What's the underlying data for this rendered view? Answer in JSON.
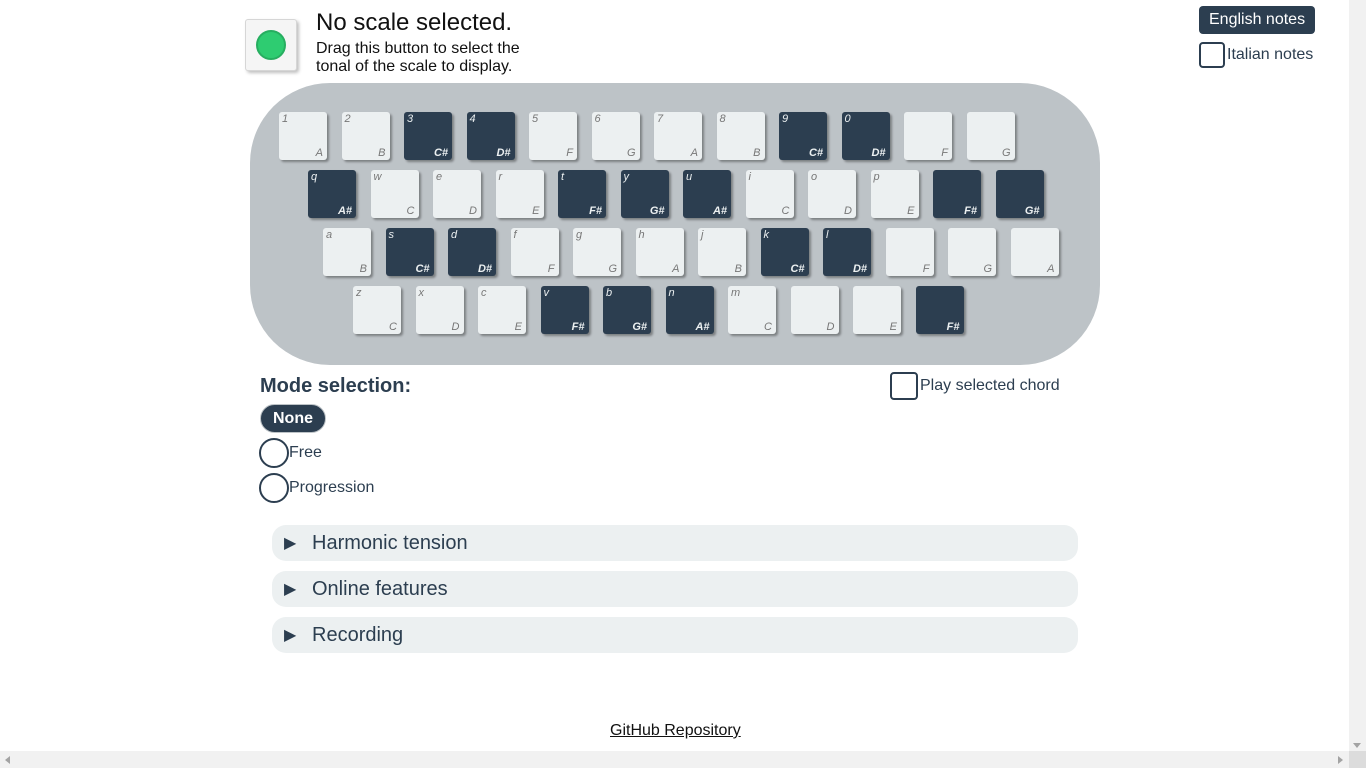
{
  "scale": {
    "title": "No scale selected.",
    "hint": "Drag this button to select the tonal of the scale to display."
  },
  "notes": {
    "english_label": "English notes",
    "italian_label": "Italian notes"
  },
  "keyboard": {
    "rows": [
      [
        {
          "key": "1",
          "note": "A",
          "color": "white"
        },
        {
          "key": "2",
          "note": "B",
          "color": "white"
        },
        {
          "key": "3",
          "note": "C#",
          "color": "black"
        },
        {
          "key": "4",
          "note": "D#",
          "color": "black"
        },
        {
          "key": "5",
          "note": "F",
          "color": "white"
        },
        {
          "key": "6",
          "note": "G",
          "color": "white"
        },
        {
          "key": "7",
          "note": "A",
          "color": "white"
        },
        {
          "key": "8",
          "note": "B",
          "color": "white"
        },
        {
          "key": "9",
          "note": "C#",
          "color": "black"
        },
        {
          "key": "0",
          "note": "D#",
          "color": "black"
        },
        {
          "key": "",
          "note": "F",
          "color": "white"
        },
        {
          "key": "",
          "note": "G",
          "color": "white"
        }
      ],
      [
        {
          "key": "q",
          "note": "A#",
          "color": "black"
        },
        {
          "key": "w",
          "note": "C",
          "color": "white"
        },
        {
          "key": "e",
          "note": "D",
          "color": "white"
        },
        {
          "key": "r",
          "note": "E",
          "color": "white"
        },
        {
          "key": "t",
          "note": "F#",
          "color": "black"
        },
        {
          "key": "y",
          "note": "G#",
          "color": "black"
        },
        {
          "key": "u",
          "note": "A#",
          "color": "black"
        },
        {
          "key": "i",
          "note": "C",
          "color": "white"
        },
        {
          "key": "o",
          "note": "D",
          "color": "white"
        },
        {
          "key": "p",
          "note": "E",
          "color": "white"
        },
        {
          "key": "",
          "note": "F#",
          "color": "black"
        },
        {
          "key": "",
          "note": "G#",
          "color": "black"
        }
      ],
      [
        {
          "key": "a",
          "note": "B",
          "color": "white"
        },
        {
          "key": "s",
          "note": "C#",
          "color": "black"
        },
        {
          "key": "d",
          "note": "D#",
          "color": "black"
        },
        {
          "key": "f",
          "note": "F",
          "color": "white"
        },
        {
          "key": "g",
          "note": "G",
          "color": "white"
        },
        {
          "key": "h",
          "note": "A",
          "color": "white"
        },
        {
          "key": "j",
          "note": "B",
          "color": "white"
        },
        {
          "key": "k",
          "note": "C#",
          "color": "black"
        },
        {
          "key": "l",
          "note": "D#",
          "color": "black"
        },
        {
          "key": "",
          "note": "F",
          "color": "white"
        },
        {
          "key": "",
          "note": "G",
          "color": "white"
        },
        {
          "key": "",
          "note": "A",
          "color": "white"
        }
      ],
      [
        {
          "key": "z",
          "note": "C",
          "color": "white"
        },
        {
          "key": "x",
          "note": "D",
          "color": "white"
        },
        {
          "key": "c",
          "note": "E",
          "color": "white"
        },
        {
          "key": "v",
          "note": "F#",
          "color": "black"
        },
        {
          "key": "b",
          "note": "G#",
          "color": "black"
        },
        {
          "key": "n",
          "note": "A#",
          "color": "black"
        },
        {
          "key": "m",
          "note": "C",
          "color": "white"
        },
        {
          "key": "",
          "note": "D",
          "color": "white"
        },
        {
          "key": "",
          "note": "E",
          "color": "white"
        },
        {
          "key": "",
          "note": "F#",
          "color": "black"
        }
      ]
    ]
  },
  "mode": {
    "title": "Mode selection:",
    "selected_label": "None",
    "free_label": "Free",
    "progression_label": "Progression"
  },
  "chord": {
    "label": "Play selected chord"
  },
  "sections": {
    "harmonic_tension": "Harmonic tension",
    "online_features": "Online features",
    "recording": "Recording",
    "toggle_glyph": "▶"
  },
  "footer": {
    "github_label": "GitHub Repository"
  },
  "colors": {
    "primary": "#2c3e50",
    "keyboard_bg": "#bdc3c7",
    "section_bg": "#ecf0f1",
    "scale_dot": "#2ecc71"
  }
}
